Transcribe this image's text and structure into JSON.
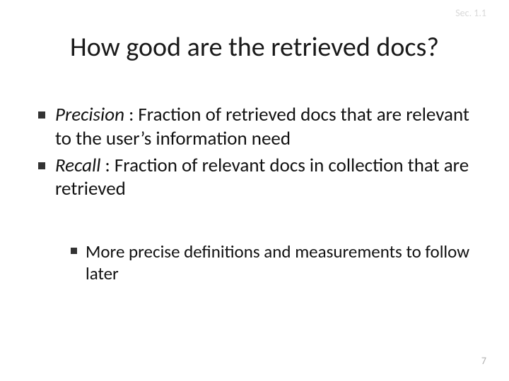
{
  "header": {
    "section_label": "Sec. 1.1"
  },
  "title": "How good are the retrieved docs?",
  "bullets": [
    {
      "term": "Precision",
      "definition": " : Fraction of retrieved docs that are relevant to the user’s information need"
    },
    {
      "term": "Recall",
      "definition": " : Fraction of relevant docs in collection that are retrieved"
    }
  ],
  "sub_bullets": [
    {
      "text": "More precise definitions and measurements to follow later"
    }
  ],
  "page_number": "7"
}
